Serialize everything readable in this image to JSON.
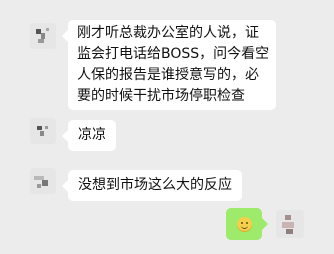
{
  "messages": [
    {
      "sender": "contact",
      "text": "刚才听总裁办公室的人说，证监会打电话给BOSS，问今看空人保的报告是谁授意写的，必要的时候干扰市场停职检查"
    },
    {
      "sender": "contact",
      "text": "凉凉"
    },
    {
      "sender": "contact",
      "text": "没想到市场这么大的反应"
    },
    {
      "sender": "self",
      "content": "smiley-emoji"
    }
  ],
  "colors": {
    "background": "#ececec",
    "incoming_bubble": "#ffffff",
    "outgoing_bubble": "#9eea6a"
  }
}
